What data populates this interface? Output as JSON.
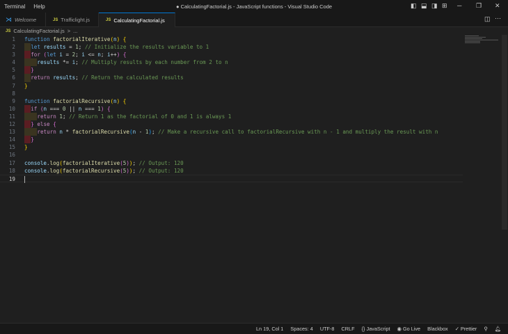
{
  "menu": [
    "Terminal",
    "Help"
  ],
  "window_title": "● CalculatingFactorial.js - JavaScript functions - Visual Studio Code",
  "tabs": [
    {
      "label": "Welcome",
      "icon": "vscode-icon",
      "modified": false,
      "active": false
    },
    {
      "label": "Trafficlight.js",
      "icon": "js-icon",
      "modified": true,
      "active": false
    },
    {
      "label": "CalculatingFactorial.js",
      "icon": "js-icon",
      "modified": true,
      "active": true
    }
  ],
  "js_badge": "JS",
  "breadcrumb": {
    "file": "CalculatingFactorial.js",
    "sep": ">",
    "rest": "..."
  },
  "code": [
    {
      "n": "1",
      "g": [],
      "t": [
        [
          "kw",
          "function "
        ],
        [
          "fn",
          "factorialIterative"
        ],
        [
          "b1",
          "("
        ],
        [
          "var",
          "n"
        ],
        [
          "b1",
          ")"
        ],
        [
          "op",
          " "
        ],
        [
          "b1",
          "{"
        ]
      ]
    },
    {
      "n": "2",
      "g": [
        "y"
      ],
      "t": [
        [
          "kw",
          "let "
        ],
        [
          "var",
          "results"
        ],
        [
          "op",
          " = "
        ],
        [
          "num",
          "1"
        ],
        [
          "op",
          "; "
        ],
        [
          "cm",
          "// Initialize the results variable to 1"
        ]
      ]
    },
    {
      "n": "3",
      "g": [
        "r"
      ],
      "t": [
        [
          "ctl",
          "for "
        ],
        [
          "b2",
          "("
        ],
        [
          "kw",
          "let "
        ],
        [
          "var",
          "i"
        ],
        [
          "op",
          " = "
        ],
        [
          "num",
          "2"
        ],
        [
          "op",
          "; "
        ],
        [
          "var",
          "i"
        ],
        [
          "op",
          " <= "
        ],
        [
          "var",
          "n"
        ],
        [
          "op",
          "; "
        ],
        [
          "var",
          "i"
        ],
        [
          "op",
          "++"
        ],
        [
          "b2",
          ")"
        ],
        [
          "op",
          " "
        ],
        [
          "b2",
          "{"
        ]
      ]
    },
    {
      "n": "4",
      "g": [
        "y",
        "y"
      ],
      "t": [
        [
          "var",
          "results"
        ],
        [
          "op",
          " *= "
        ],
        [
          "var",
          "i"
        ],
        [
          "op",
          "; "
        ],
        [
          "cm",
          "// Multiply results by each number from 2 to n"
        ]
      ]
    },
    {
      "n": "5",
      "g": [
        "r"
      ],
      "t": [
        [
          "b2",
          "}"
        ]
      ]
    },
    {
      "n": "6",
      "g": [
        "y"
      ],
      "t": [
        [
          "ctl",
          "return "
        ],
        [
          "var",
          "results"
        ],
        [
          "op",
          "; "
        ],
        [
          "cm",
          "// Return the calculated results"
        ]
      ]
    },
    {
      "n": "7",
      "g": [],
      "t": [
        [
          "b1",
          "}"
        ]
      ]
    },
    {
      "n": "8",
      "g": [],
      "t": []
    },
    {
      "n": "9",
      "g": [],
      "t": [
        [
          "kw",
          "function "
        ],
        [
          "fn",
          "factorialRecursive"
        ],
        [
          "b1",
          "("
        ],
        [
          "var",
          "n"
        ],
        [
          "b1",
          ")"
        ],
        [
          "op",
          " "
        ],
        [
          "b1",
          "{"
        ]
      ]
    },
    {
      "n": "10",
      "g": [
        "r"
      ],
      "t": [
        [
          "ctl",
          "if "
        ],
        [
          "b2",
          "("
        ],
        [
          "var",
          "n"
        ],
        [
          "op",
          " === "
        ],
        [
          "num",
          "0"
        ],
        [
          "op",
          " || "
        ],
        [
          "var",
          "n"
        ],
        [
          "op",
          " === "
        ],
        [
          "num",
          "1"
        ],
        [
          "b2",
          ")"
        ],
        [
          "op",
          " "
        ],
        [
          "b2",
          "{"
        ]
      ]
    },
    {
      "n": "11",
      "g": [
        "y",
        "y"
      ],
      "t": [
        [
          "ctl",
          "return "
        ],
        [
          "num",
          "1"
        ],
        [
          "op",
          "; "
        ],
        [
          "cm",
          "// Return 1 as the factorial of 0 and 1 is always 1"
        ]
      ]
    },
    {
      "n": "12",
      "g": [
        "r"
      ],
      "t": [
        [
          "b2",
          "}"
        ],
        [
          "op",
          " "
        ],
        [
          "ctl",
          "else "
        ],
        [
          "b2",
          "{"
        ]
      ]
    },
    {
      "n": "13",
      "g": [
        "y",
        "y"
      ],
      "t": [
        [
          "ctl",
          "return "
        ],
        [
          "var",
          "n"
        ],
        [
          "op",
          " * "
        ],
        [
          "fn",
          "factorialRecursive"
        ],
        [
          "b3",
          "("
        ],
        [
          "var",
          "n"
        ],
        [
          "op",
          " - "
        ],
        [
          "num",
          "1"
        ],
        [
          "b3",
          ")"
        ],
        [
          "op",
          "; "
        ],
        [
          "cm",
          "// Make a recursive call to factorialRecursive with n - 1 and multiply the result with n"
        ]
      ]
    },
    {
      "n": "14",
      "g": [
        "r"
      ],
      "t": [
        [
          "b2",
          "}"
        ]
      ]
    },
    {
      "n": "15",
      "g": [],
      "t": [
        [
          "b1",
          "}"
        ]
      ]
    },
    {
      "n": "16",
      "g": [],
      "t": []
    },
    {
      "n": "17",
      "g": [],
      "t": [
        [
          "var",
          "console"
        ],
        [
          "op",
          "."
        ],
        [
          "fn",
          "log"
        ],
        [
          "b1",
          "("
        ],
        [
          "fn",
          "factorialIterative"
        ],
        [
          "b2",
          "("
        ],
        [
          "num",
          "5"
        ],
        [
          "b2",
          ")"
        ],
        [
          "b1",
          ")"
        ],
        [
          "op",
          "; "
        ],
        [
          "cm",
          "// Output: 120"
        ]
      ]
    },
    {
      "n": "18",
      "g": [],
      "t": [
        [
          "var",
          "console"
        ],
        [
          "op",
          "."
        ],
        [
          "fn",
          "log"
        ],
        [
          "b1",
          "("
        ],
        [
          "fn",
          "factorialRecursive"
        ],
        [
          "b2",
          "("
        ],
        [
          "num",
          "5"
        ],
        [
          "b2",
          ")"
        ],
        [
          "b1",
          ")"
        ],
        [
          "op",
          "; "
        ],
        [
          "cm",
          "// Output: 120"
        ]
      ]
    },
    {
      "n": "19",
      "g": [],
      "t": [],
      "cursor": true
    }
  ],
  "status": {
    "position": "Ln 19, Col 1",
    "spaces": "Spaces: 4",
    "encoding": "UTF-8",
    "eol": "CRLF",
    "language": "{} JavaScript",
    "golive": "Go Live",
    "blackbox": "Blackbox",
    "prettier": "✓ Prettier"
  }
}
